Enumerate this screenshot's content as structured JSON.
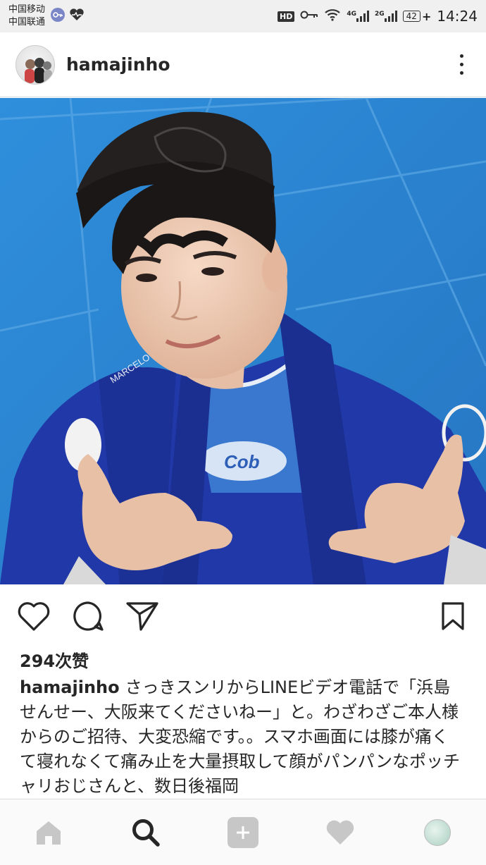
{
  "status_bar": {
    "carrier1": "中国移动",
    "carrier2": "中国联通",
    "hd": "HD",
    "net1": "4G",
    "net2": "2G",
    "battery": "42",
    "time": "14:24"
  },
  "post": {
    "username": "hamajinho",
    "likes": "294次赞",
    "caption_user": "hamajinho",
    "caption_text": "さっきスンリからLINEビデオ電話で「浜島せんせー、大阪来てくださいねー」と。わざわざご本人様からのご招待、大変恐縮です。。スマホ画面には膝が痛くて寝れなくて痛み止を大量摂取して顔がパンパンなポッチャリおじさんと、数日後福岡"
  },
  "photo": {
    "gi_patch_text": "MARCELO GARCIA",
    "shirt_text": "Cob"
  },
  "icons": {
    "home": "home-icon",
    "search": "search-icon",
    "add": "add-icon",
    "activity": "heart-icon",
    "profile": "profile-avatar"
  },
  "colors": {
    "mat_blue": "#2c87d2",
    "gi_blue": "#1f3aa6",
    "text": "#262626"
  }
}
